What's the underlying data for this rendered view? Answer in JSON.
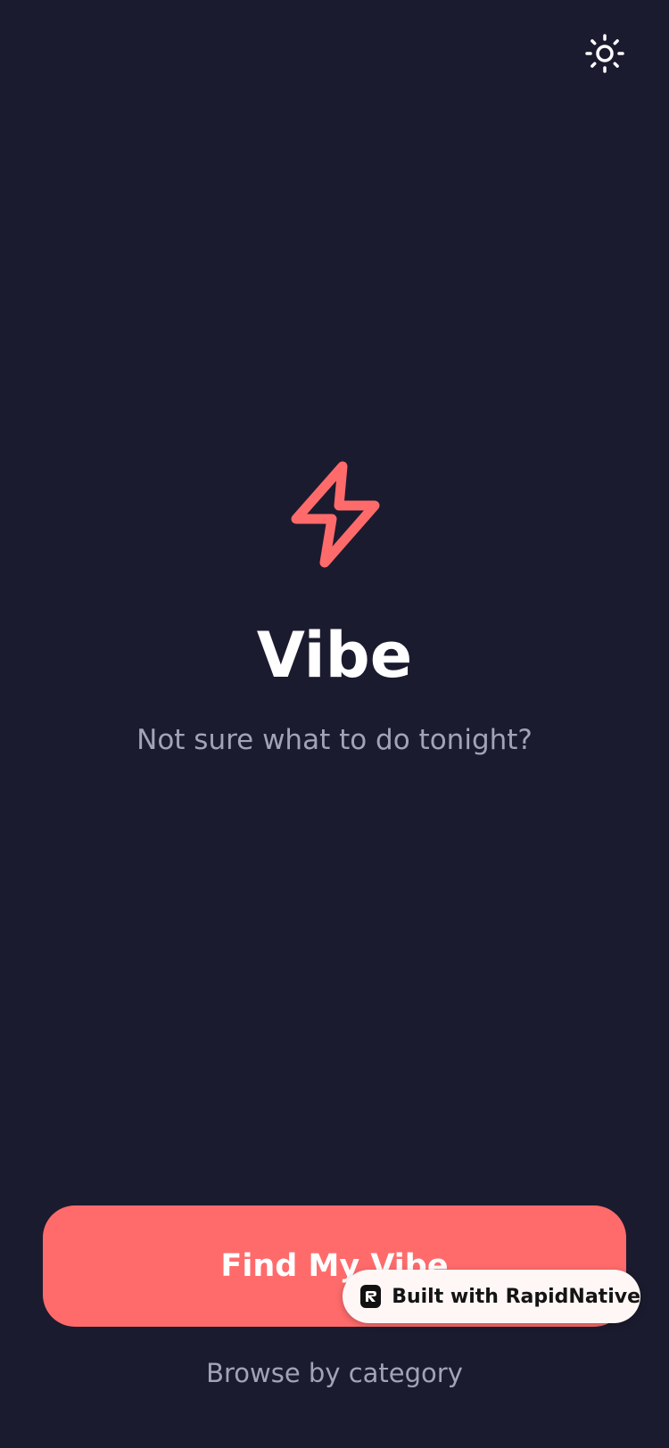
{
  "app": {
    "title": "Vibe",
    "subtitle": "Not sure what to do tonight?"
  },
  "header": {
    "theme_toggle_icon": "sun-icon"
  },
  "logo": {
    "icon": "lightning-bolt-icon",
    "color": "#ff6b6b"
  },
  "actions": {
    "primary_label": "Find My Vibe",
    "secondary_label": "Browse by category"
  },
  "badge": {
    "icon": "rapidnative-logo-icon",
    "label": "Built with RapidNative"
  },
  "colors": {
    "background": "#1b1b2f",
    "accent": "#ff6b6b",
    "muted_text": "#a3a3b8",
    "badge_background": "#fff7f6"
  }
}
